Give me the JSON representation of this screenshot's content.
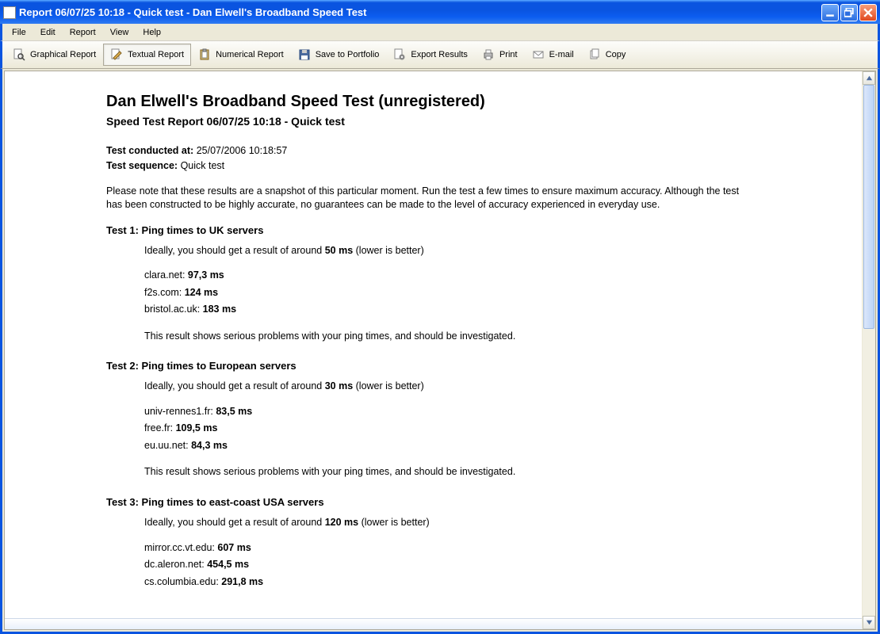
{
  "window": {
    "title": "Report 06/07/25 10:18 - Quick test - Dan Elwell's Broadband Speed Test"
  },
  "menubar": {
    "items": [
      "File",
      "Edit",
      "Report",
      "View",
      "Help"
    ]
  },
  "toolbar": {
    "buttons": [
      {
        "id": "graphical-report",
        "label": "Graphical Report",
        "icon": "magnifier-page",
        "active": false
      },
      {
        "id": "textual-report",
        "label": "Textual Report",
        "icon": "pencil-page",
        "active": true
      },
      {
        "id": "numerical-report",
        "label": "Numerical Report",
        "icon": "clipboard",
        "active": false
      },
      {
        "id": "save-portfolio",
        "label": "Save to Portfolio",
        "icon": "floppy",
        "active": false
      },
      {
        "id": "export-results",
        "label": "Export Results",
        "icon": "gear-doc",
        "active": false
      },
      {
        "id": "print",
        "label": "Print",
        "icon": "printer",
        "active": false
      },
      {
        "id": "email",
        "label": "E-mail",
        "icon": "envelope",
        "active": false
      },
      {
        "id": "copy",
        "label": "Copy",
        "icon": "two-pages",
        "active": false
      }
    ]
  },
  "report": {
    "title": "Dan Elwell's Broadband Speed Test (unregistered)",
    "subtitle": "Speed Test Report 06/07/25 10:18 - Quick test",
    "meta": {
      "conducted_label": "Test conducted at:",
      "conducted_value": "25/07/2006 10:18:57",
      "sequence_label": "Test sequence:",
      "sequence_value": "Quick test"
    },
    "note": "Please note that these results are a snapshot of this particular moment. Run the test a few times to ensure maximum accuracy. Although the test has been constructed to be highly accurate, no guarantees can be made to the level of accuracy experienced in everyday use.",
    "tests": [
      {
        "heading": "Test 1: Ping times to UK servers",
        "ideal_prefix": "Ideally, you should get a result of around ",
        "ideal_target": "50 ms",
        "ideal_suffix": " (lower is better)",
        "pings": [
          {
            "host": "clara.net:",
            "value": "97,3 ms"
          },
          {
            "host": "f2s.com:",
            "value": "124 ms"
          },
          {
            "host": "bristol.ac.uk:",
            "value": "183 ms"
          }
        ],
        "assessment": "This result shows serious problems with your ping times, and should be investigated."
      },
      {
        "heading": "Test 2: Ping times to European servers",
        "ideal_prefix": "Ideally, you should get a result of around ",
        "ideal_target": "30 ms",
        "ideal_suffix": " (lower is better)",
        "pings": [
          {
            "host": "univ-rennes1.fr:",
            "value": "83,5 ms"
          },
          {
            "host": "free.fr:",
            "value": "109,5 ms"
          },
          {
            "host": "eu.uu.net:",
            "value": "84,3 ms"
          }
        ],
        "assessment": "This result shows serious problems with your ping times, and should be investigated."
      },
      {
        "heading": "Test 3: Ping times to east-coast USA servers",
        "ideal_prefix": "Ideally, you should get a result of around ",
        "ideal_target": "120 ms",
        "ideal_suffix": " (lower is better)",
        "pings": [
          {
            "host": "mirror.cc.vt.edu:",
            "value": "607 ms"
          },
          {
            "host": "dc.aleron.net:",
            "value": "454,5 ms"
          },
          {
            "host": "cs.columbia.edu:",
            "value": "291,8 ms"
          }
        ],
        "assessment": ""
      }
    ]
  }
}
